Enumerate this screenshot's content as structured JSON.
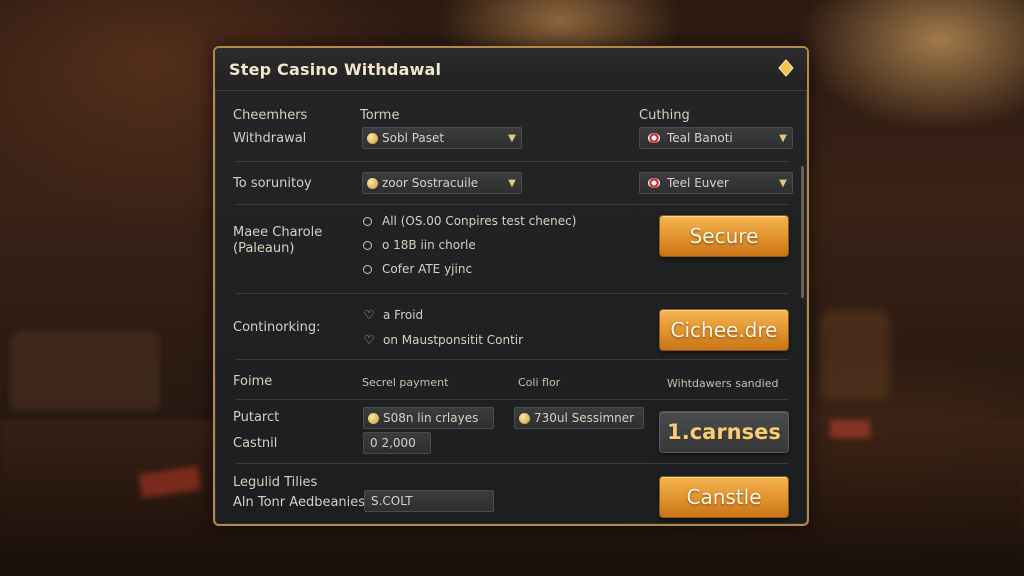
{
  "window": {
    "title": "Step Casino Withdawal",
    "icon": "diamond-icon"
  },
  "colors": {
    "accent": "#e1922c",
    "border": "#b48a4a",
    "panel": "#1f2122"
  },
  "headers": {
    "col1": "Cheemhers",
    "col2": "Torme",
    "col3": "Cuthing"
  },
  "row1": {
    "label": "Withdrawal",
    "select1": "Sobl Paset",
    "select2": "Teal Banoti"
  },
  "row2": {
    "label": "To sorunitoy",
    "select1": "zoor Sostracuile",
    "select2": "Teel Euver"
  },
  "row3": {
    "label_line1": "Maee Charole",
    "label_line2": "(Paleaun)",
    "options": [
      "All (OS.00 Conpires test chenec)",
      "o 18B iin chorle",
      "Cofer ATE yjinc"
    ],
    "button": "Secure"
  },
  "row4": {
    "label": "Continorking:",
    "options": [
      "a Froid",
      "on Maustponsitit Contir"
    ],
    "button": "Cichee.dre"
  },
  "row5": {
    "label": "Foime",
    "col1": "Secrel payment",
    "col2": "Coli flor",
    "col3": "Wihtdawers sandied"
  },
  "row6": {
    "label1": "Putarct",
    "label2": "Castnil",
    "field1": "S08n lin crlayes",
    "field2": "730ul Sessimner",
    "field3": "0 2,000",
    "button": "1.carnses"
  },
  "row7": {
    "label1": "Legulid Tilies",
    "label2": "Aln Tonr Aedbeanies",
    "field": "S.COLT",
    "button": "Canstle"
  }
}
